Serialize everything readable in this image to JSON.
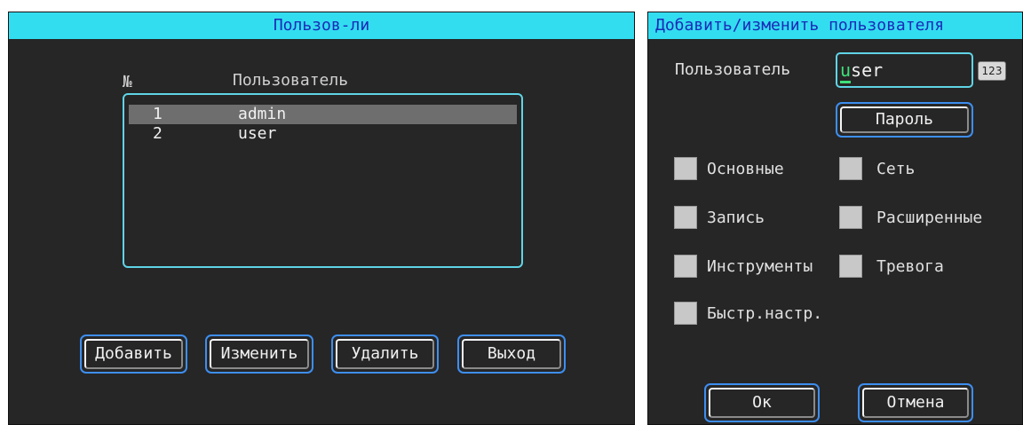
{
  "users_panel": {
    "title": "Пользов-ли",
    "column_number": "№",
    "column_user": "Пользователь",
    "rows": [
      {
        "num": "1",
        "name": "admin",
        "selected": true
      },
      {
        "num": "2",
        "name": "user",
        "selected": false
      }
    ],
    "buttons": {
      "add": "Добавить",
      "edit": "Изменить",
      "delete": "Удалить",
      "exit": "Выход"
    }
  },
  "edit_panel": {
    "title": "Добавить/изменить пользователя",
    "user_label": "Пользователь",
    "user_value_first": "u",
    "user_value_rest": "ser",
    "ime_label": "123",
    "password_button": "Пароль",
    "permissions": {
      "basic": "Основные",
      "network": "Сеть",
      "record": "Запись",
      "advanced": "Расширенные",
      "tools": "Инструменты",
      "alarm": "Тревога",
      "quick_setup": "Быстр.настр."
    },
    "ok_button": "Ок",
    "cancel_button": "Отмена"
  },
  "colors": {
    "title_bar": "#33ddf0",
    "title_text": "#1b2ab8",
    "panel_bg": "#262626",
    "button_border": "#3d8ef0",
    "list_border": "#5fd4e6",
    "caret": "#3ee07a"
  }
}
